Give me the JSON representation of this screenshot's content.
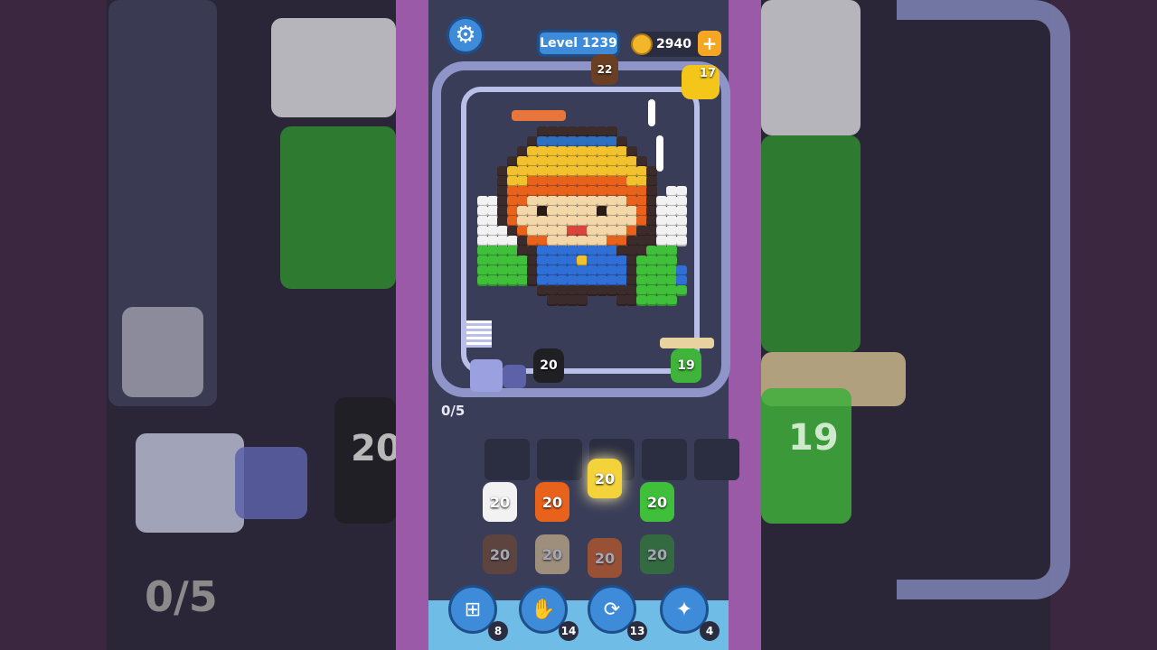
{
  "hud": {
    "level_label": "Level 1239",
    "coins": "2940",
    "coin_plus": "+"
  },
  "board": {
    "progress": "0/5",
    "top_shooter_count": "22",
    "key_count": "17",
    "track_shooters": [
      {
        "count": "20",
        "color": "#202024"
      },
      {
        "count": "19",
        "color": "#3fb33a"
      }
    ]
  },
  "queue": {
    "active": [
      {
        "count": "20",
        "color": "#f2f2f2"
      },
      {
        "count": "20",
        "color": "#e8621c"
      },
      {
        "count": "20",
        "color": "#f4d33a"
      },
      {
        "count": "20",
        "color": "#3fbf3a"
      }
    ],
    "next": [
      {
        "count": "20",
        "color": "#7a4a2a"
      },
      {
        "count": "20",
        "color": "#f0d29a"
      },
      {
        "count": "20",
        "color": "#e8621c"
      },
      {
        "count": "20",
        "color": "#2e8f2e"
      }
    ]
  },
  "powerups": [
    {
      "name": "add-slot",
      "icon": "plus-card-icon",
      "count": "8"
    },
    {
      "name": "hand",
      "icon": "hand-icon",
      "count": "14"
    },
    {
      "name": "shuffle",
      "icon": "shuffle-icon",
      "count": "13"
    },
    {
      "name": "magic",
      "icon": "bunny-icon",
      "count": "4"
    }
  ],
  "ghost": {
    "left_progress": "0/5",
    "left_count": "20",
    "right_count": "19"
  }
}
